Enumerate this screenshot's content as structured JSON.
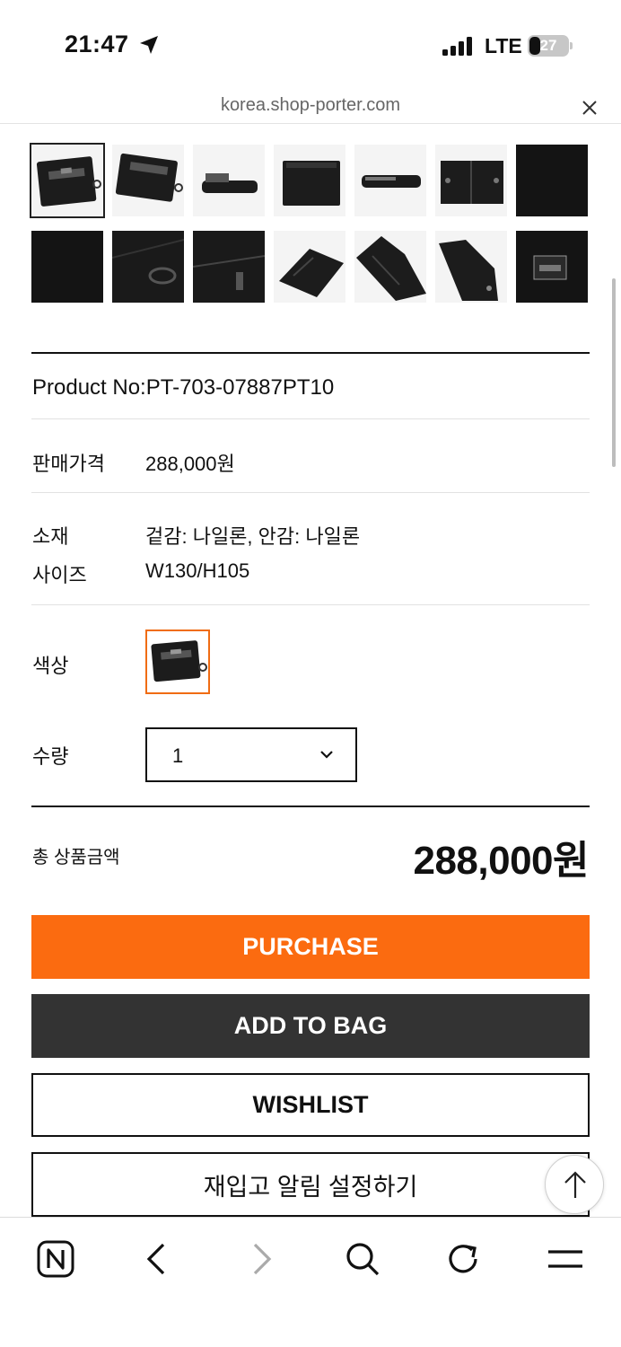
{
  "status_bar": {
    "time": "21:47",
    "network": "LTE",
    "battery": "27"
  },
  "browser": {
    "url": "korea.shop-porter.com"
  },
  "gallery": {
    "thumbnails": [
      "wallet-front",
      "wallet-angle",
      "wallet-side",
      "wallet-back",
      "wallet-top",
      "wallet-open",
      "wallet-detail-dark",
      "fabric-closeup",
      "wallet-ring",
      "wallet-zip",
      "wallet-card-slots",
      "wallet-open-inside",
      "wallet-interior",
      "logo-label"
    ]
  },
  "product": {
    "product_no": "Product No:PT-703-07887PT10",
    "price_label": "판매가격",
    "price_value": "288,000원",
    "material_label": "소재",
    "material_value": "겉감: 나일론, 안감: 나일론",
    "size_label": "사이즈",
    "size_value": "W130/H105",
    "color_label": "색상",
    "qty_label": "수량",
    "qty_value": "1"
  },
  "total": {
    "label": "총 상품금액",
    "value": "288,000원"
  },
  "buttons": {
    "purchase": "PURCHASE",
    "add_to_bag": "ADD TO BAG",
    "wishlist": "WISHLIST",
    "restock": "재입고 알림 설정하기"
  },
  "colors": {
    "accent": "#fb6b10",
    "dark_button": "#333333"
  },
  "toolbar_icons": [
    "naver-home-icon",
    "back-icon",
    "forward-icon",
    "search-icon",
    "reload-icon",
    "menu-icon"
  ]
}
